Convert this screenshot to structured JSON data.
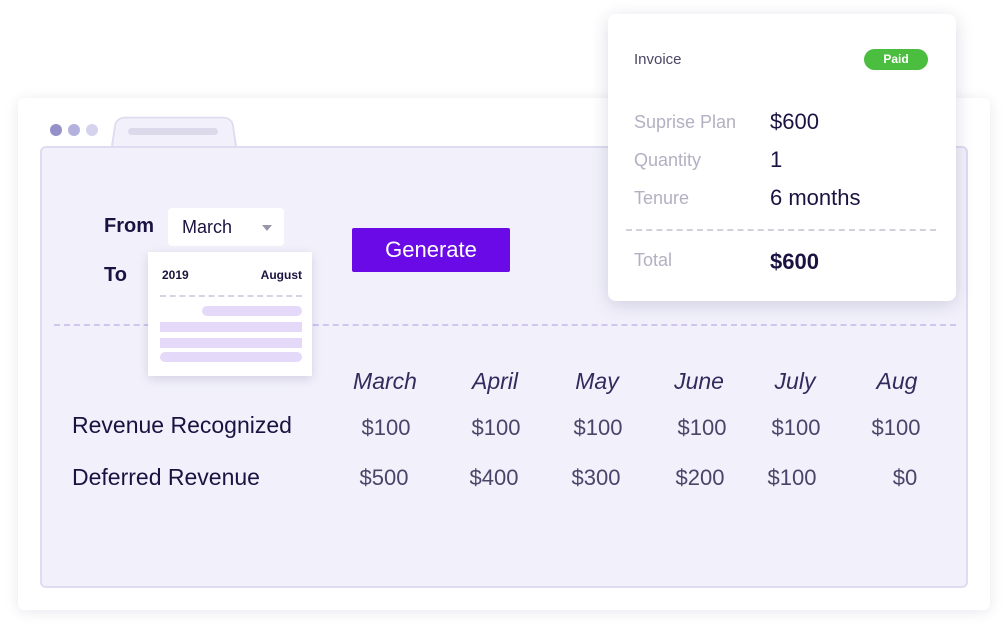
{
  "colors": {
    "accent": "#6a0ae6",
    "paid_badge": "#4bbd3f",
    "panel_bg": "#f2f1fb",
    "window_dots": [
      "#9591c8",
      "#b5b1de",
      "#d5d2ee"
    ]
  },
  "form": {
    "from_label": "From",
    "from_value": "March",
    "to_label": "To",
    "generate_label": "Generate"
  },
  "calendar": {
    "year": "2019",
    "month": "August"
  },
  "table": {
    "months": [
      "March",
      "April",
      "May",
      "June",
      "July",
      "Aug"
    ],
    "rows": [
      {
        "label": "Revenue Recognized",
        "values": [
          "$100",
          "$100",
          "$100",
          "$100",
          "$100",
          "$100"
        ]
      },
      {
        "label": "Deferred Revenue",
        "values": [
          "$500",
          "$400",
          "$300",
          "$200",
          "$100",
          "$0"
        ]
      }
    ]
  },
  "invoice": {
    "title": "Invoice",
    "status": "Paid",
    "items": [
      {
        "label": "Suprise Plan",
        "value": "$600"
      },
      {
        "label": "Quantity",
        "value": "1"
      },
      {
        "label": "Tenure",
        "value": "6 months"
      }
    ],
    "total_label": "Total",
    "total_value": "$600"
  }
}
